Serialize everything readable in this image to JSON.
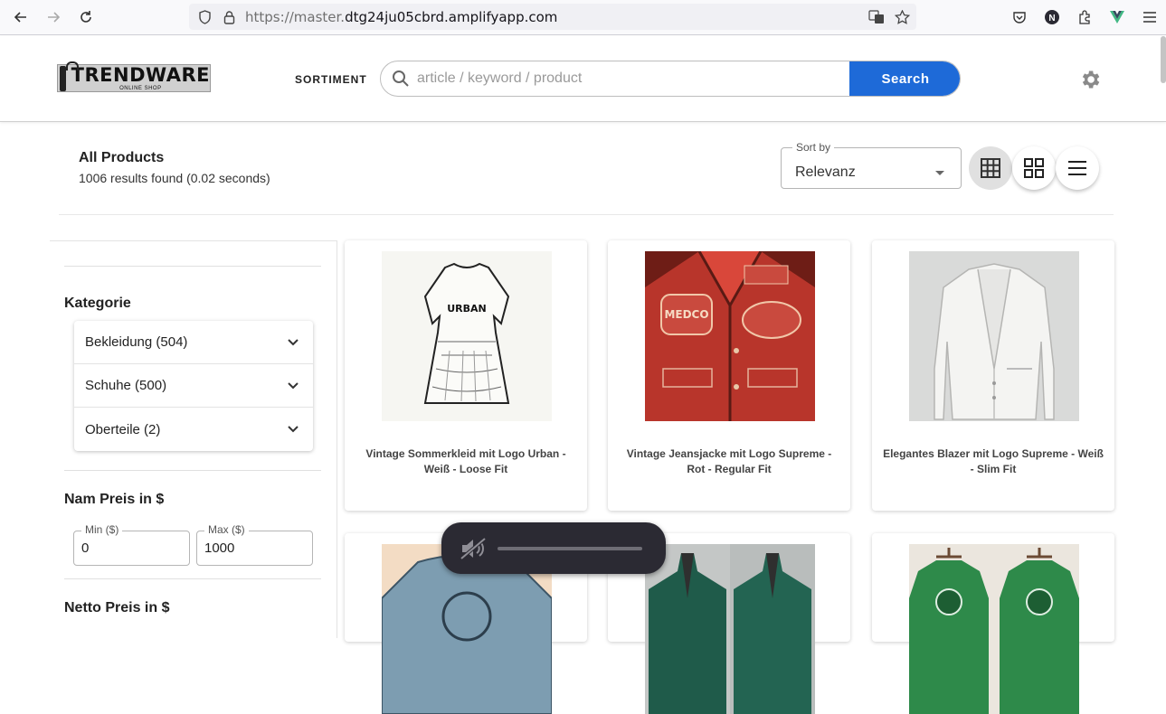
{
  "browser": {
    "url_dim": "https://master.",
    "url_main": "dtg24ju05cbrd.amplifyapp.com",
    "icons": [
      "back-icon",
      "forward-icon",
      "reload-icon",
      "shield-icon",
      "lock-icon",
      "translate-icon",
      "star-icon",
      "pocket-icon",
      "account-icon",
      "extensions-icon",
      "vue-icon",
      "menu-icon"
    ]
  },
  "header": {
    "logo_main": "TRENDWARE",
    "logo_sub": "ONLINE SHOP",
    "nav_label": "SORTIMENT",
    "search_placeholder": "article / keyword / product",
    "search_button": "Search"
  },
  "results": {
    "title": "All Products",
    "count_text": "1006 results found (0.02 seconds)",
    "sort_label": "Sort by",
    "sort_value": "Relevanz"
  },
  "sidebar": {
    "category_heading": "Kategorie",
    "categories": [
      {
        "label": "Bekleidung (504)"
      },
      {
        "label": "Schuhe (500)"
      },
      {
        "label": "Oberteile (2)"
      }
    ],
    "nam_price_heading": "Nam Preis in $",
    "min_label": "Min ($)",
    "min_value": "0",
    "max_label": "Max ($)",
    "max_value": "1000",
    "netto_price_heading": "Netto Preis in $"
  },
  "products": [
    {
      "title": "Vintage Sommerkleid mit Logo Urban - Weiß - Loose Fit",
      "print": "URBAN"
    },
    {
      "title": "Vintage Jeansjacke mit Logo Supreme - Rot - Regular Fit",
      "print": "MEDCO"
    },
    {
      "title": "Elegantes Blazer mit Logo Supreme - Weiß - Slim Fit",
      "print": ""
    },
    {
      "title": "",
      "print": ""
    },
    {
      "title": "",
      "print": ""
    },
    {
      "title": "",
      "print": ""
    }
  ],
  "colors": {
    "accent": "#1e6ad8",
    "media_bg": "#2b2a33"
  }
}
